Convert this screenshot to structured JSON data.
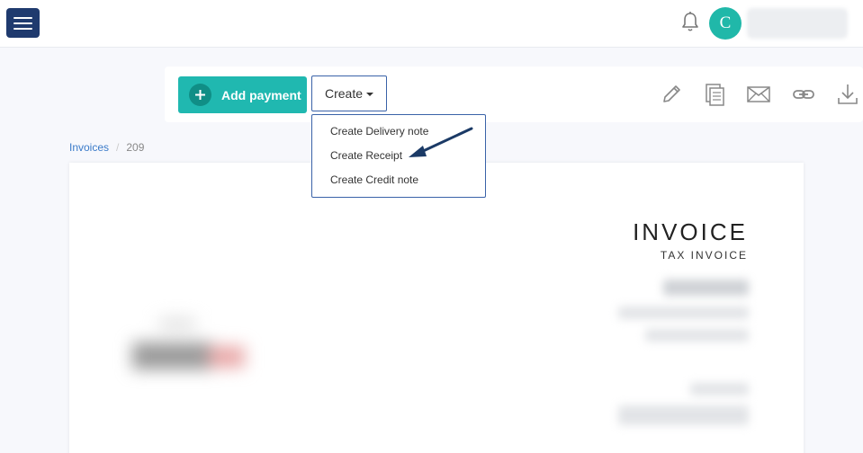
{
  "topbar": {
    "menu_icon": "hamburger-menu-icon",
    "notification_icon": "bell-icon",
    "avatar_initial": "C",
    "username": ""
  },
  "toolbar": {
    "add_payment_label": "Add payment",
    "create_label": "Create",
    "icons": [
      "edit-pencil-icon",
      "copy-document-icon",
      "email-envelope-icon",
      "link-icon",
      "download-icon"
    ]
  },
  "create_menu": {
    "items": [
      {
        "label": "Create Delivery note"
      },
      {
        "label": "Create Receipt"
      },
      {
        "label": "Create Credit note"
      }
    ]
  },
  "breadcrumb": {
    "parent": "Invoices",
    "separator": "/",
    "current": "209"
  },
  "invoice": {
    "title": "INVOICE",
    "subtitle": "TAX INVOICE"
  },
  "colors": {
    "brand_navy": "#1f3a6e",
    "accent_teal": "#20b8b0",
    "link_blue": "#3b7bc9",
    "arrow": "#1b3a66"
  }
}
